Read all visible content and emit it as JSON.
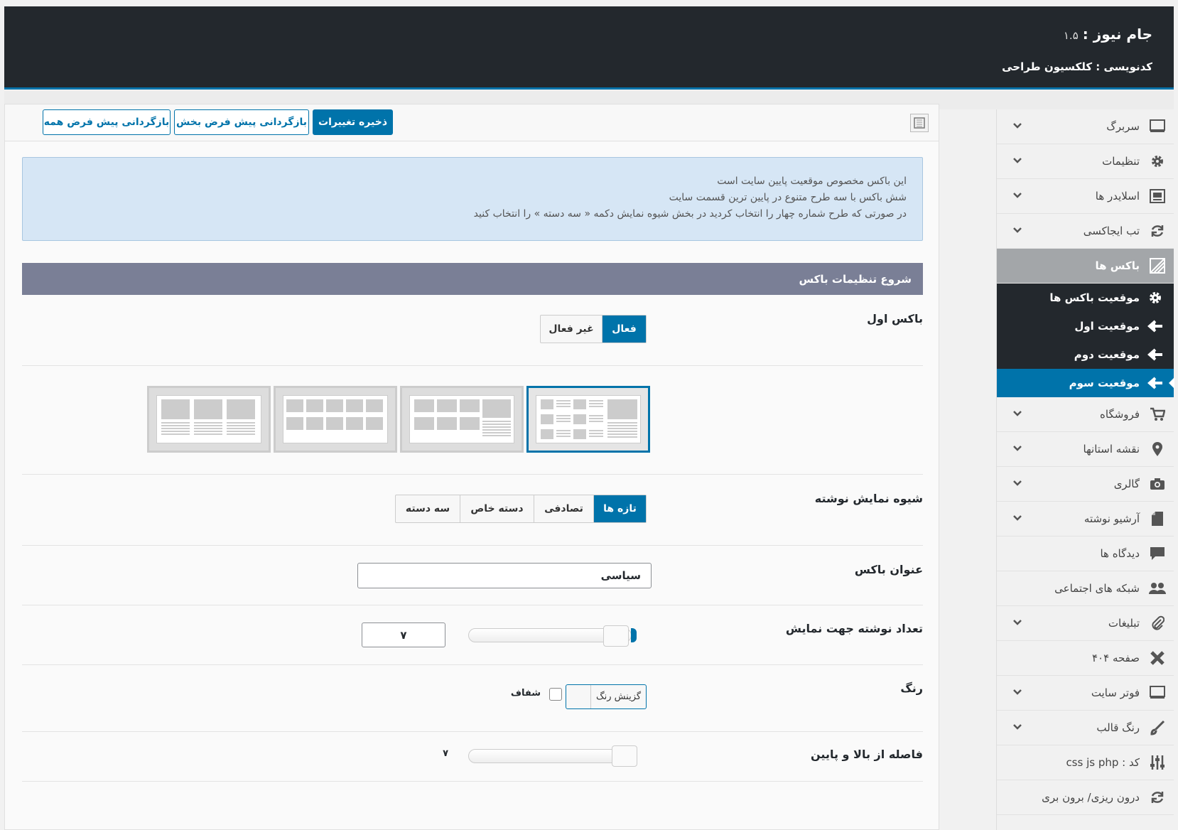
{
  "header": {
    "title": "جام نیوز :",
    "version": "۱.۵",
    "subtitle": "کدنویسی : کلکسیون طراحی"
  },
  "toolbar": {
    "save_label": "ذخیره تغییرات",
    "reset_section_label": "بازگردانی پیش فرض بخش",
    "reset_all_label": "بازگردانی پیش فرض همه"
  },
  "sidebar": {
    "items_top": [
      {
        "label": "سربرگ",
        "icon": "monitor-icon"
      },
      {
        "label": "تنظیمات",
        "icon": "gear-icon"
      },
      {
        "label": "اسلایدر ها",
        "icon": "slider-icon"
      },
      {
        "label": "تب ایجاکسی",
        "icon": "refresh-icon"
      }
    ],
    "active": {
      "label": "باکس ها",
      "icon": "boxes-icon"
    },
    "sub": [
      {
        "label": "موقعیت باکس ها",
        "icon": "gear-icon"
      },
      {
        "label": "موقعیت اول",
        "icon": "arrow-left-icon"
      },
      {
        "label": "موقعیت دوم",
        "icon": "arrow-left-icon"
      },
      {
        "label": "موقعیت سوم",
        "icon": "arrow-left-icon"
      }
    ],
    "items_bottom": [
      {
        "label": "فروشگاه",
        "icon": "cart-icon",
        "chev": true
      },
      {
        "label": "نقشه استانها",
        "icon": "location-pin-icon",
        "chev": true
      },
      {
        "label": "گالری",
        "icon": "camera-icon",
        "chev": true
      },
      {
        "label": "آرشیو نوشته",
        "icon": "archive-icon",
        "chev": true
      },
      {
        "label": "دیدگاه ها",
        "icon": "comment-icon",
        "chev": false
      },
      {
        "label": "شبکه های اجتماعی",
        "icon": "users-icon",
        "chev": false
      },
      {
        "label": "تبلیغات",
        "icon": "paperclip-icon",
        "chev": true
      },
      {
        "label": "صفحه ۴۰۴",
        "icon": "close-icon",
        "chev": false
      },
      {
        "label": "فوتر سایت",
        "icon": "monitor-icon",
        "chev": true
      },
      {
        "label": "رنگ قالب",
        "icon": "brush-icon",
        "chev": true
      },
      {
        "label": "کد : css js php",
        "icon": "sliders-icon",
        "chev": false
      },
      {
        "label": "درون ریزی/ برون بری",
        "icon": "refresh-icon",
        "chev": false
      }
    ]
  },
  "notice": {
    "line1": "این باکس مخصوص موقعیت پایین سایت است",
    "line2": "شش باکس با سه طرح متنوع در پایین ترین قسمت سایت",
    "line3": "در صورتی که طرح شماره چهار را انتخاب کردید در بخش شیوه نمایش دکمه « سه دسته » را انتخاب کنید"
  },
  "section": {
    "title": "شروع تنظیمات باکس"
  },
  "box_first": {
    "label": "باکس اول",
    "on": "فعال",
    "off": "غیر فعال"
  },
  "display": {
    "label": "شیوه نمایش نوشته",
    "options": [
      "تازه ها",
      "تصادفی",
      "دسته خاص",
      "سه دسته"
    ]
  },
  "box_title": {
    "label": "عنوان باکس",
    "value": "سیاسی"
  },
  "post_count": {
    "label": "تعداد نوشته جهت نمایش",
    "value": "۷"
  },
  "color": {
    "label": "رنگ",
    "pick": "گزینش رنگ",
    "transparent": "شفاف"
  },
  "spacing": {
    "label": "فاصله از بالا و پایین",
    "value": "۷"
  },
  "colors": {
    "accent": "#0073aa",
    "header_bg": "#23282d",
    "section_bar": "#7a7f96",
    "notice_bg": "#d6e6f5"
  }
}
